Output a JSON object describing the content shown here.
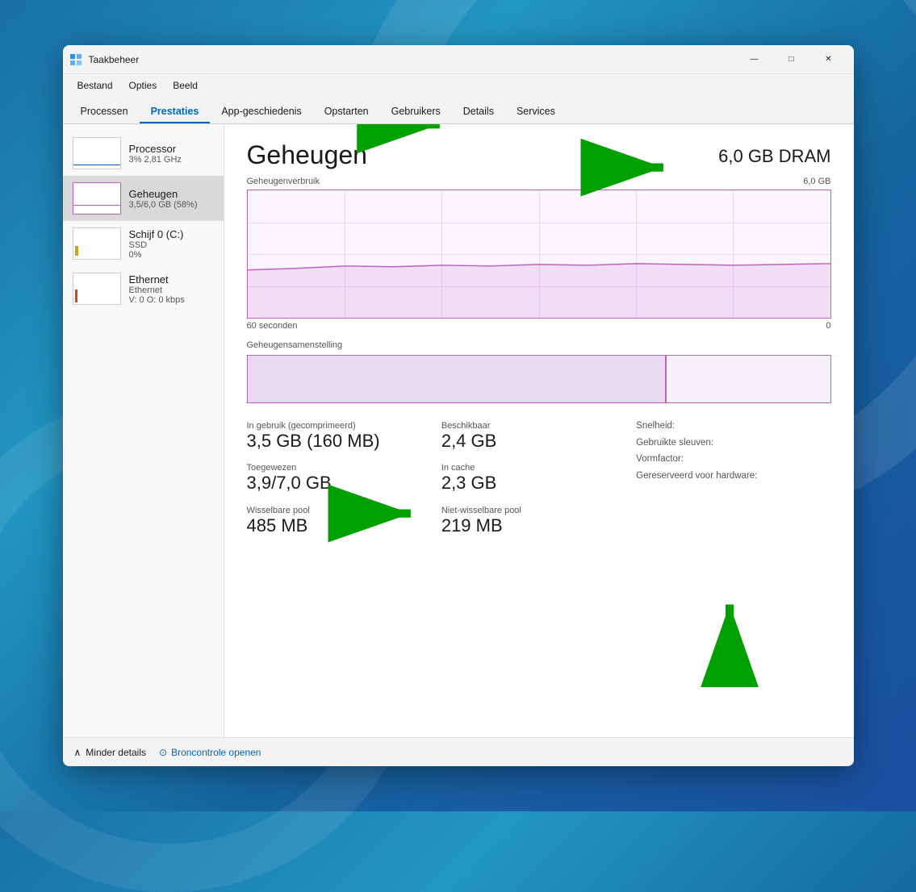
{
  "window": {
    "title": "Taakbeheer",
    "icon": "task-manager"
  },
  "titlebar": {
    "minimize_label": "—",
    "maximize_label": "□",
    "close_label": "✕"
  },
  "menubar": {
    "items": [
      "Bestand",
      "Opties",
      "Beeld"
    ]
  },
  "tabs": [
    {
      "label": "Processen",
      "active": false
    },
    {
      "label": "Prestaties",
      "active": true
    },
    {
      "label": "App-geschiedenis",
      "active": false
    },
    {
      "label": "Opstarten",
      "active": false
    },
    {
      "label": "Gebruikers",
      "active": false
    },
    {
      "label": "Details",
      "active": false
    },
    {
      "label": "Services",
      "active": false
    }
  ],
  "sidebar": {
    "items": [
      {
        "name": "Processor",
        "sub1": "3%  2,81 GHz",
        "type": "processor"
      },
      {
        "name": "Geheugen",
        "sub1": "3,5/6,0 GB (58%)",
        "type": "memory"
      },
      {
        "name": "Schijf 0 (C:)",
        "sub1": "SSD",
        "sub2": "0%",
        "type": "disk"
      },
      {
        "name": "Ethernet",
        "sub1": "Ethernet",
        "sub2": "V: 0  O: 0 kbps",
        "type": "ethernet"
      }
    ]
  },
  "detail": {
    "title": "Geheugen",
    "dram": "6,0 GB DRAM",
    "usage_label": "Geheugenverbruik",
    "usage_max": "6,0 GB",
    "time_label": "60 seconden",
    "time_zero": "0",
    "composition_label": "Geheugensamenstelling",
    "stats": {
      "in_gebruik_label": "In gebruik (gecomprimeerd)",
      "in_gebruik_value": "3,5 GB (160 MB)",
      "beschikbaar_label": "Beschikbaar",
      "beschikbaar_value": "2,4 GB",
      "snelheid_label": "Snelheid:",
      "gebruikte_sleuven_label": "Gebruikte sleuven:",
      "vormfactor_label": "Vormfactor:",
      "gereserveerd_label": "Gereserveerd voor hardware:",
      "toegewezen_label": "Toegewezen",
      "toegewezen_value": "3,9/7,0 GB",
      "in_cache_label": "In cache",
      "in_cache_value": "2,3 GB",
      "wisselbare_label": "Wisselbare pool",
      "wisselbare_value": "485 MB",
      "niet_wisselbare_label": "Niet-wisselbare pool",
      "niet_wisselbare_value": "219 MB"
    }
  },
  "footer": {
    "less_details_label": "Minder details",
    "resource_monitor_label": "Broncontrole openen"
  }
}
